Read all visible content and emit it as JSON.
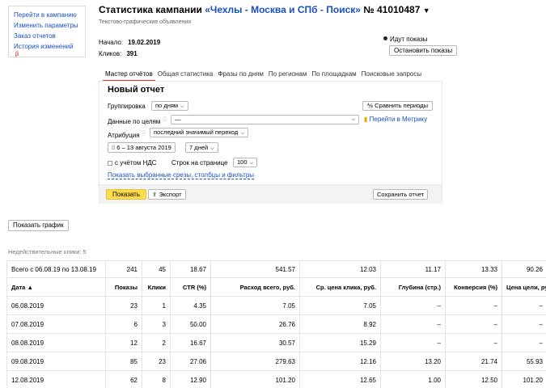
{
  "leftnav": {
    "items": [
      "Перейти в кампанию",
      "Изменить параметры",
      "Заказ отчетов",
      "История изменений"
    ],
    "mark": "β"
  },
  "header": {
    "title_prefix": "Статистика кампании",
    "campaign": "«Чехлы - Москва и СПб - Поиск»",
    "number": "№ 41010487",
    "arrow": "▼",
    "subtitle": "Текстово-графические объявления",
    "start_label": "Начало:",
    "start_value": "19.02.2019",
    "clicks_label": "Кликов:",
    "clicks_value": "391",
    "shows_status": "Идут показы",
    "stop_button": "Остановить показы"
  },
  "tabs": [
    "Мастер отчётов",
    "Общая статистика",
    "Фразы по дням",
    "По регионам",
    "По площадкам",
    "Поисковые запросы"
  ],
  "report": {
    "title": "Новый отчет",
    "grouping_label": "Группировка",
    "grouping_value": "по дням",
    "compare_button": "Сравнить периоды",
    "goals_label": "Данные по целям",
    "goals_value": "—",
    "metrika_link": "Перейти в Метрику",
    "attribution_label": "Атрибуция",
    "attribution_value": "последний значимый переход",
    "date_range": "6 – 13 августа 2019",
    "period": "7 дней",
    "vat_label": "с учётом НДС",
    "rows_label": "Строк на странице",
    "rows_value": "100",
    "slices_link": "Показать выбранные срезы, столбцы и фильтры",
    "show_button": "Показать",
    "export_button": "Экспорт",
    "save_button": "Сохранить отчет"
  },
  "chart_button": "Показать график",
  "invalid_clicks": "Недействительные клики: 5",
  "table": {
    "totals": [
      "Всего с 06.08.19 по 13.08.19",
      "241",
      "45",
      "18.67",
      "541.57",
      "12.03",
      "11.17",
      "13.33",
      "90.26"
    ],
    "headers": [
      "Дата ▲",
      "Показы",
      "Клики",
      "CTR (%)",
      "Расход всего, руб.",
      "Ср. цена клика, руб.",
      "Глубина (стр.)",
      "Конверсия (%)",
      "Цена цели, руб."
    ],
    "rows": [
      [
        "06.08.2019",
        "23",
        "1",
        "4.35",
        "7.05",
        "7.05",
        "–",
        "–",
        "–"
      ],
      [
        "07.08.2019",
        "6",
        "3",
        "50.00",
        "26.76",
        "8.92",
        "–",
        "–",
        "–"
      ],
      [
        "08.08.2019",
        "12",
        "2",
        "16.67",
        "30.57",
        "15.29",
        "–",
        "–",
        "–"
      ],
      [
        "09.08.2019",
        "85",
        "23",
        "27.06",
        "279.63",
        "12.16",
        "13.20",
        "21.74",
        "55.93"
      ],
      [
        "12.08.2019",
        "62",
        "8",
        "12.90",
        "101.20",
        "12.65",
        "1.00",
        "12.50",
        "101.20"
      ]
    ]
  }
}
